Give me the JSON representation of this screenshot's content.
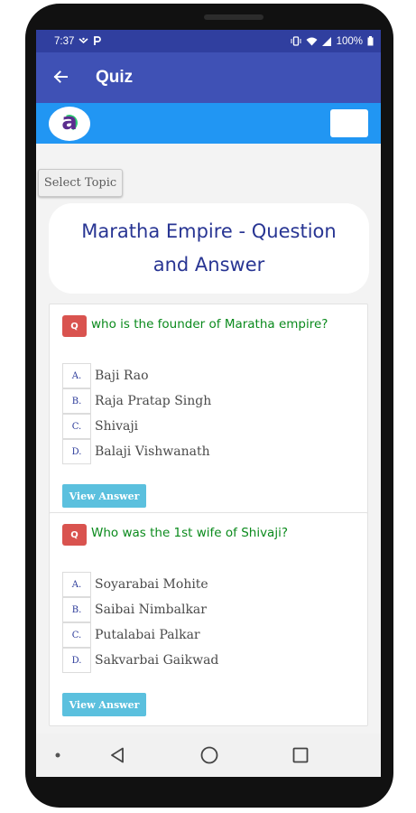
{
  "status_bar": {
    "time": "7:37",
    "battery": "100%"
  },
  "app_bar": {
    "title": "Quiz"
  },
  "brand": {
    "logo_letter": "a"
  },
  "select_topic_label": "Select Topic",
  "page_title": "Maratha Empire - Question and Answer",
  "questions": [
    {
      "badge": "Q",
      "text": "who is the founder of Maratha empire?",
      "options": [
        {
          "letter": "A.",
          "text": "Baji Rao"
        },
        {
          "letter": "B.",
          "text": "Raja Pratap Singh"
        },
        {
          "letter": "C.",
          "text": "Shivaji"
        },
        {
          "letter": "D.",
          "text": "Balaji Vishwanath"
        }
      ],
      "button_label": "View Answer"
    },
    {
      "badge": "Q",
      "text": "Who was the 1st wife of Shivaji?",
      "options": [
        {
          "letter": "A.",
          "text": "Soyarabai Mohite"
        },
        {
          "letter": "B.",
          "text": "Saibai Nimbalkar"
        },
        {
          "letter": "C.",
          "text": "Putalabai Palkar"
        },
        {
          "letter": "D.",
          "text": "Sakvarbai Gaikwad"
        }
      ],
      "button_label": "View Answer"
    }
  ],
  "colors": {
    "status_bar": "#303f9f",
    "app_bar": "#3f51b5",
    "brand_bar": "#2196f3",
    "question_text": "#0a8a1c",
    "badge": "#d9534f",
    "view_button": "#5bc0de",
    "title_text": "#283593"
  }
}
